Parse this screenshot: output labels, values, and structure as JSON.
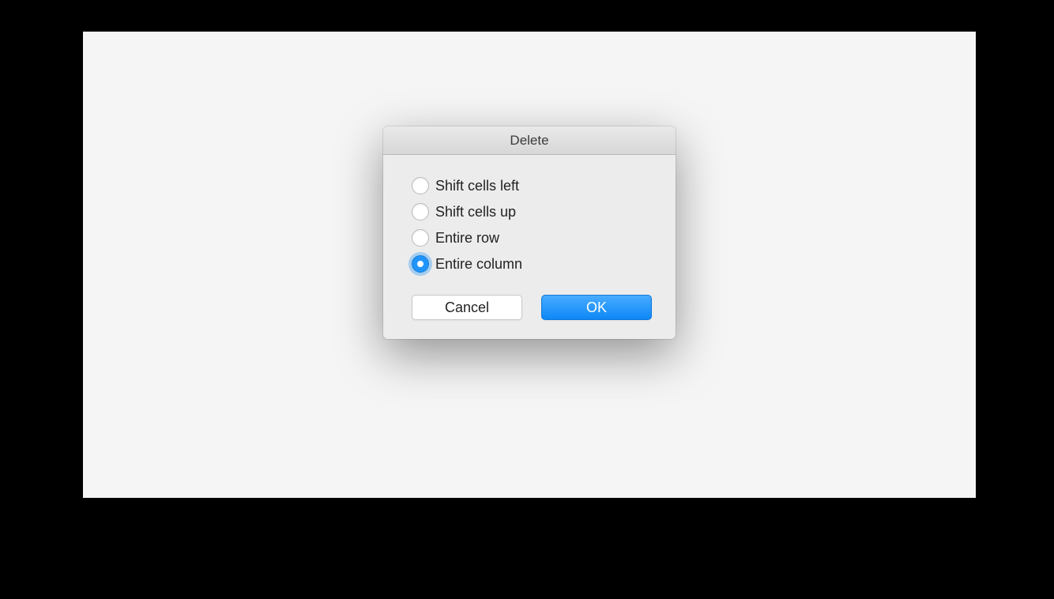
{
  "dialog": {
    "title": "Delete",
    "options": [
      {
        "label": "Shift cells left",
        "selected": false
      },
      {
        "label": "Shift cells up",
        "selected": false
      },
      {
        "label": "Entire row",
        "selected": false
      },
      {
        "label": "Entire column",
        "selected": true
      }
    ],
    "cancel_label": "Cancel",
    "ok_label": "OK"
  }
}
